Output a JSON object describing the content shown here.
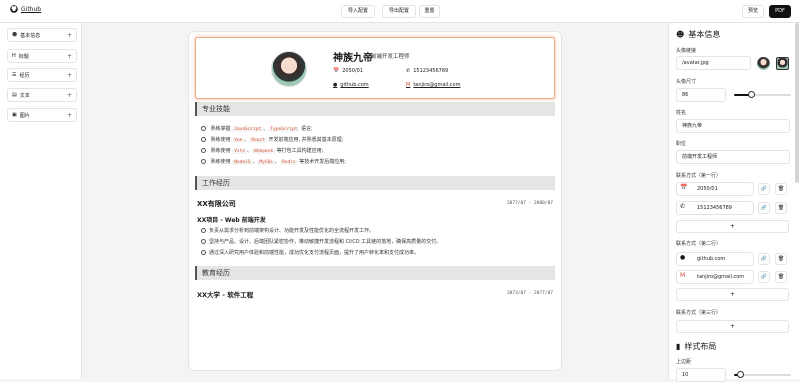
{
  "topbar": {
    "brand": "Github",
    "import_label": "导入配置",
    "export_label": "导出配置",
    "reset_label": "重置",
    "preview_label": "预览",
    "pdf_label": "PDF"
  },
  "sidebar": {
    "items": [
      {
        "label": "基本信息",
        "icon": "user-icon"
      },
      {
        "label": "标题",
        "icon": "heading-icon"
      },
      {
        "label": "经历",
        "icon": "list-icon"
      },
      {
        "label": "文本",
        "icon": "text-icon"
      },
      {
        "label": "图片",
        "icon": "image-icon"
      }
    ]
  },
  "resume": {
    "name": "神族九帝",
    "title": "前端开发工程师",
    "birth": "2050/01",
    "phone": "15123456789",
    "github": "github.com",
    "email": "tanjiro@gmail.com",
    "skills_heading": "专业技能",
    "skills": [
      {
        "pre": "熟练掌握",
        "codes": [
          "JavaScript",
          "TypeScript"
        ],
        "post": "语言;"
      },
      {
        "pre": "熟练使用",
        "codes": [
          "Vue",
          "React"
        ],
        "post": "开发前端应用, 并熟悉其基本原理;"
      },
      {
        "pre": "熟练使用",
        "codes": [
          "Vite",
          "Webpack"
        ],
        "post": "等打包工具构建应用;"
      },
      {
        "pre": "熟练使用",
        "codes": [
          "NodeJS",
          "MySQL",
          "Redis"
        ],
        "post": "等技术开发后端应用;"
      }
    ],
    "work_heading": "工作经历",
    "company": "XX有限公司",
    "company_date": "2077/07 - 2080/07",
    "project": "XX项目 - Web 前端开发",
    "work_items": [
      "负责从需求分析到前端架构设计、功能开发及性能优化的全流程开发工作。",
      "坚持与产品、设计、后端团队紧密协作，推动敏捷开发流程和 CI/CD 工具链的落地，确保高质量的交付。",
      "通过深入研究用户体验和前端性能，成功优化支付流程页面，提升了用户转化率和支付成功率。"
    ],
    "edu_heading": "教育经历",
    "school": "XX大学 - 软件工程",
    "school_date": "2073/07 - 2077/07"
  },
  "panel": {
    "basic_heading": "基本信息",
    "avatar_label": "头像链接",
    "avatar_value": "/avatar.jpg",
    "avatar_size_label": "头像尺寸",
    "avatar_size_value": "86",
    "avatar_size_level": 0.3,
    "name_label": "姓名",
    "name_value": "神族九帝",
    "job_label": "职位",
    "job_value": "前端开发工程师",
    "contact1_label": "联系方式（第一行）",
    "contact1": [
      {
        "icon": "calendar-icon",
        "value": "2050/01"
      },
      {
        "icon": "phone-icon",
        "value": "15123456789"
      }
    ],
    "contact2_label": "联系方式（第二行）",
    "contact2": [
      {
        "icon": "github-icon",
        "value": "github.com"
      },
      {
        "icon": "gmail-icon",
        "value": "tanjiro@gmail.com"
      }
    ],
    "contact3_label": "联系方式（第三行）",
    "add_symbol": "+",
    "style_heading": "样式布局",
    "margin_label": "上边距",
    "margin_value": "10",
    "margin_level": 0.1
  }
}
